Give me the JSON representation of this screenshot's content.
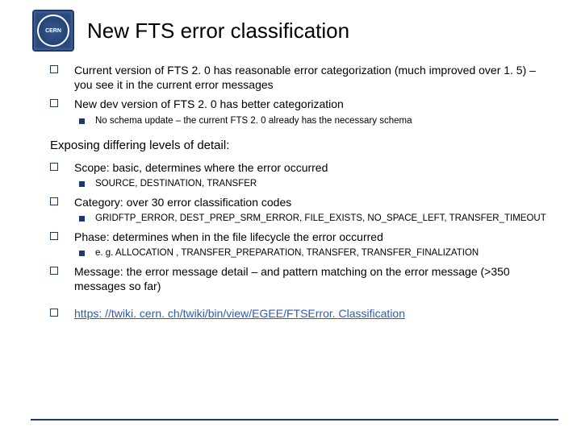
{
  "logo_text": "CERN",
  "title": "New FTS error classification",
  "bullets_top": [
    "Current version of FTS 2. 0 has reasonable error categorization (much improved over 1. 5) – you see it in the current error messages",
    "New dev version of FTS 2. 0 has better categorization"
  ],
  "sub_no_schema": "No schema update – the current FTS 2. 0 already has the necessary schema",
  "subhead": "Exposing differing levels of detail:",
  "scope": {
    "label": "Scope:",
    "text": " basic, determines where the error occurred",
    "sub": "SOURCE, DESTINATION, TRANSFER"
  },
  "category": {
    "label": "Category:",
    "text": " over 30 error classification codes",
    "sub": "GRIDFTP_ERROR, DEST_PREP_SRM_ERROR, FILE_EXISTS, NO_SPACE_LEFT, TRANSFER_TIMEOUT"
  },
  "phase": {
    "label": "Phase:",
    "text": " determines when in the file lifecycle the error occurred",
    "sub": "e. g. ALLOCATION , TRANSFER_PREPARATION, TRANSFER, TRANSFER_FINALIZATION"
  },
  "message": {
    "label": "Message:",
    "text": " the error message detail – and pattern matching on the error message (>350 messages so far)"
  },
  "link": "https: //twiki. cern. ch/twiki/bin/view/EGEE/FTSError. Classification"
}
